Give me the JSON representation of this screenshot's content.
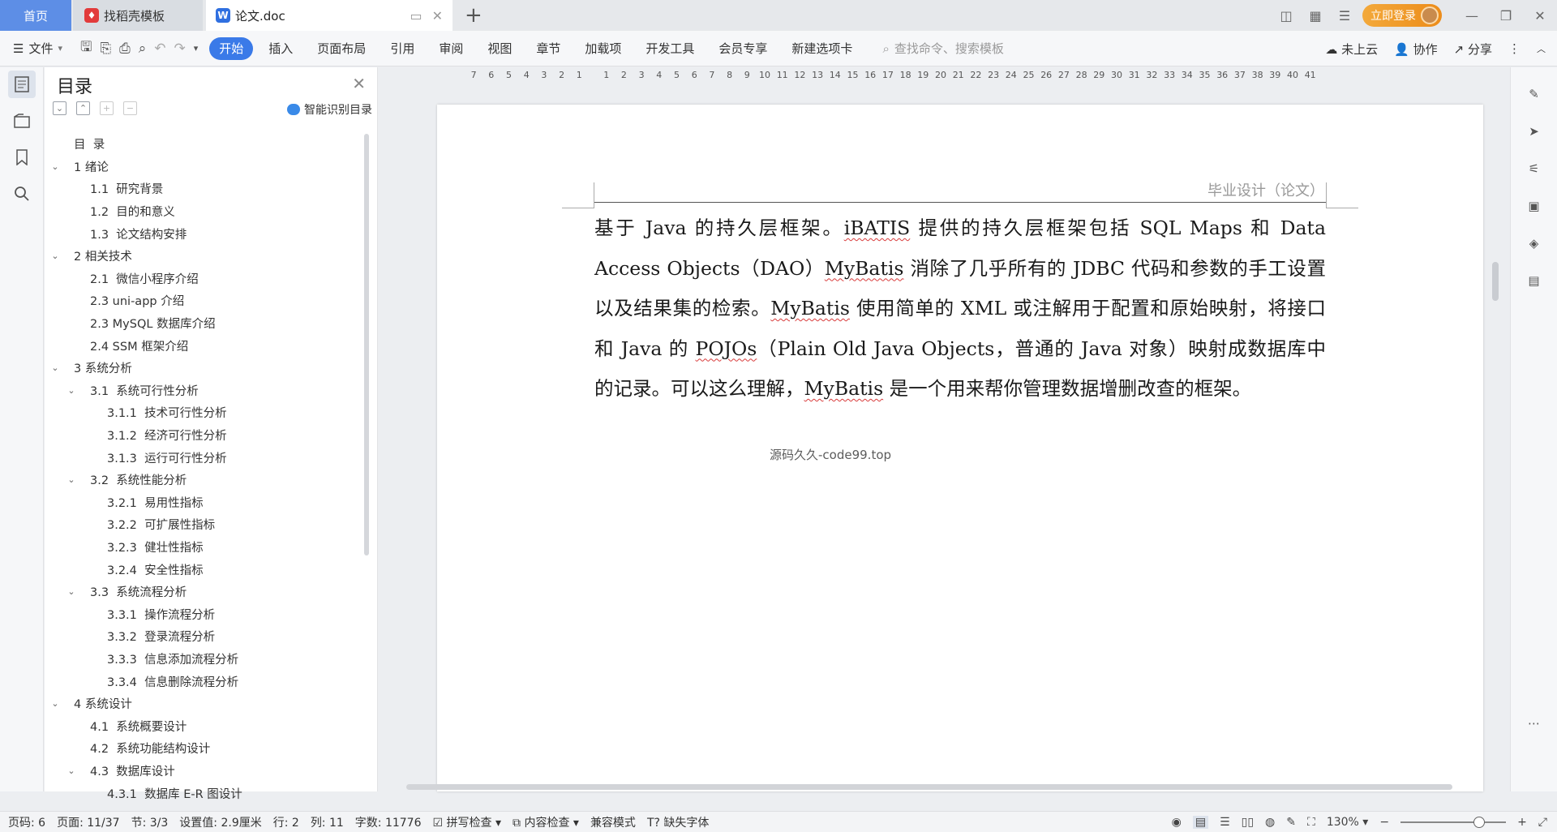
{
  "titlebar": {
    "tabs": [
      {
        "label": "首页"
      },
      {
        "label": "找稻壳模板"
      },
      {
        "label": "论文.doc"
      }
    ],
    "login_label": "立即登录"
  },
  "ribbon": {
    "file_label": "文件",
    "menu": [
      "开始",
      "插入",
      "页面布局",
      "引用",
      "审阅",
      "视图",
      "章节",
      "加载项",
      "开发工具",
      "会员专享",
      "新建选项卡"
    ],
    "search_placeholder": "查找命令、搜索模板",
    "cloud_label": "未上云",
    "collab_label": "协作",
    "share_label": "分享"
  },
  "toc": {
    "title": "目录",
    "smart_label": "智能识别目录",
    "items": [
      {
        "label": "目  录",
        "level": 0,
        "chev": false
      },
      {
        "label": "1 绪论",
        "level": 0,
        "chev": true
      },
      {
        "label": "1.1  研究背景",
        "level": 1,
        "chev": false
      },
      {
        "label": "1.2  目的和意义",
        "level": 1,
        "chev": false
      },
      {
        "label": "1.3  论文结构安排",
        "level": 1,
        "chev": false
      },
      {
        "label": "2 相关技术",
        "level": 0,
        "chev": true
      },
      {
        "label": "2.1  微信小程序介绍",
        "level": 1,
        "chev": false
      },
      {
        "label": "2.3 uni-app 介绍",
        "level": 1,
        "chev": false
      },
      {
        "label": "2.3 MySQL 数据库介绍",
        "level": 1,
        "chev": false
      },
      {
        "label": "2.4 SSM 框架介绍",
        "level": 1,
        "chev": false
      },
      {
        "label": "3 系统分析",
        "level": 0,
        "chev": true
      },
      {
        "label": "3.1  系统可行性分析",
        "level": 1,
        "chev": true
      },
      {
        "label": "3.1.1  技术可行性分析",
        "level": 2,
        "chev": false
      },
      {
        "label": "3.1.2  经济可行性分析",
        "level": 2,
        "chev": false
      },
      {
        "label": "3.1.3  运行可行性分析",
        "level": 2,
        "chev": false
      },
      {
        "label": "3.2  系统性能分析",
        "level": 1,
        "chev": true
      },
      {
        "label": "3.2.1  易用性指标",
        "level": 2,
        "chev": false
      },
      {
        "label": "3.2.2  可扩展性指标",
        "level": 2,
        "chev": false
      },
      {
        "label": "3.2.3  健壮性指标",
        "level": 2,
        "chev": false
      },
      {
        "label": "3.2.4  安全性指标",
        "level": 2,
        "chev": false
      },
      {
        "label": "3.3  系统流程分析",
        "level": 1,
        "chev": true
      },
      {
        "label": "3.3.1  操作流程分析",
        "level": 2,
        "chev": false
      },
      {
        "label": "3.3.2  登录流程分析",
        "level": 2,
        "chev": false
      },
      {
        "label": "3.3.3  信息添加流程分析",
        "level": 2,
        "chev": false
      },
      {
        "label": "3.3.4  信息删除流程分析",
        "level": 2,
        "chev": false
      },
      {
        "label": "4 系统设计",
        "level": 0,
        "chev": true
      },
      {
        "label": "4.1  系统概要设计",
        "level": 1,
        "chev": false
      },
      {
        "label": "4.2  系统功能结构设计",
        "level": 1,
        "chev": false
      },
      {
        "label": "4.3  数据库设计",
        "level": 1,
        "chev": true
      },
      {
        "label": "4.3.1  数据库 E-R 图设计",
        "level": 2,
        "chev": false
      }
    ]
  },
  "ruler": {
    "left_ticks": [
      "7",
      "6",
      "5",
      "4",
      "3",
      "2",
      "1"
    ],
    "right_ticks": [
      "1",
      "2",
      "3",
      "4",
      "5",
      "6",
      "7",
      "8",
      "9",
      "10",
      "11",
      "12",
      "13",
      "14",
      "15",
      "16",
      "17",
      "18",
      "19",
      "20",
      "21",
      "22",
      "23",
      "24",
      "25",
      "26",
      "27",
      "28",
      "29",
      "30",
      "31",
      "32",
      "33",
      "34",
      "35",
      "36",
      "37",
      "38",
      "39",
      "40",
      "41"
    ]
  },
  "document": {
    "header": "毕业设计（论文）",
    "watermark": "源码久久-code99.top",
    "segments": [
      {
        "t": "基于 Java 的持久层框架。",
        "s": false
      },
      {
        "t": "iBATIS",
        "s": true
      },
      {
        "t": " 提供的持久层框架包括 SQL Maps 和 Data Access Objects（DAO）",
        "s": false
      },
      {
        "t": "MyBatis",
        "s": true
      },
      {
        "t": " 消除了几乎所有的 JDBC 代码和参数的手工设置以及结果集的检索。",
        "s": false
      },
      {
        "t": "MyBatis",
        "s": true
      },
      {
        "t": " 使用简单的 XML 或注解用于配置和原始映射，将接口和 Java 的 ",
        "s": false
      },
      {
        "t": "POJOs",
        "s": true
      },
      {
        "t": "（Plain Old Java Objects，普通的 Java 对象）映射成数据库中的记录。可以这么理解，",
        "s": false
      },
      {
        "t": "MyBatis",
        "s": true
      },
      {
        "t": " 是一个用来帮你管理数据增删改查的框架。",
        "s": false
      }
    ]
  },
  "statusbar": {
    "page_code": "页码: 6",
    "page": "页面: 11/37",
    "section": "节: 3/3",
    "setting": "设置值: 2.9厘米",
    "row": "行: 2",
    "col": "列: 11",
    "words": "字数: 11776",
    "spell": "拼写检查",
    "content_check": "内容检查",
    "compat": "兼容模式",
    "missing_font": "缺失字体",
    "zoom": "130%"
  }
}
